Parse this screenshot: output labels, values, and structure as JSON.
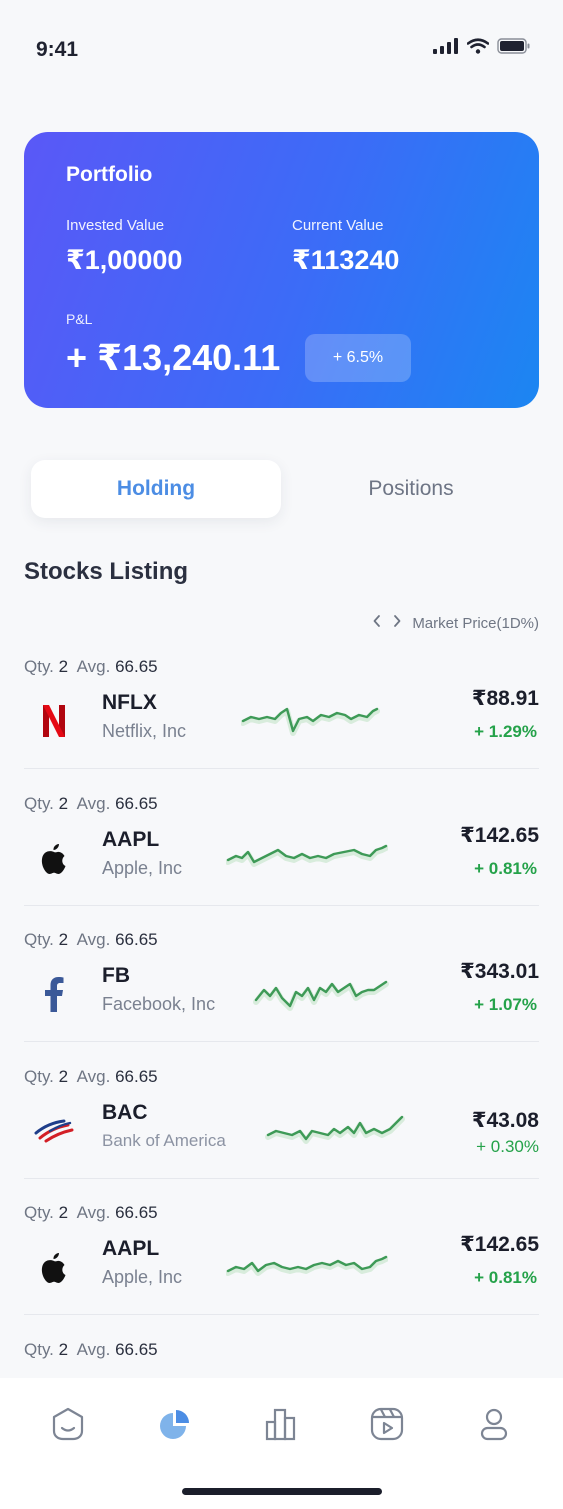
{
  "status_bar": {
    "time": "9:41"
  },
  "portfolio": {
    "title": "Portfolio",
    "invested_label": "Invested Value",
    "invested_value": "₹1,00000",
    "current_label": "Current Value",
    "current_value": "₹113240",
    "pl_label": "P&L",
    "pl_value": "+ ₹13,240.11",
    "pl_percent": "+ 6.5%"
  },
  "tabs": {
    "holding": "Holding",
    "positions": "Positions",
    "active": "Holding"
  },
  "listing": {
    "title": "Stocks Listing",
    "market_price_label": "Market Price(1D%)",
    "qty_label": "Qty.",
    "avg_label": "Avg.",
    "stocks": [
      {
        "qty": "2",
        "avg": "66.65",
        "symbol": "NFLX",
        "name": "Netflix, Inc",
        "price": "₹88.91",
        "change": "+ 1.29%",
        "logo": "netflix-logo"
      },
      {
        "qty": "2",
        "avg": "66.65",
        "symbol": "AAPL",
        "name": "Apple, Inc",
        "price": "₹142.65",
        "change": "+ 0.81%",
        "logo": "apple-logo"
      },
      {
        "qty": "2",
        "avg": "66.65",
        "symbol": "FB",
        "name": "Facebook, Inc",
        "price": "₹343.01",
        "change": "+ 1.07%",
        "logo": "facebook-logo"
      },
      {
        "qty": "2",
        "avg": "66.65",
        "symbol": "BAC",
        "name": "Bank of America",
        "price": "₹43.08",
        "change": "+ 0.30%",
        "logo": "bank-of-america-logo"
      },
      {
        "qty": "2",
        "avg": "66.65",
        "symbol": "AAPL",
        "name": "Apple, Inc",
        "price": "₹142.65",
        "change": "+ 0.81%",
        "logo": "apple-logo"
      }
    ],
    "partial_row": {
      "qty": "2",
      "avg": "66.65"
    }
  },
  "nav": {
    "items": [
      "home-icon",
      "portfolio-pie-icon",
      "bar-chart-icon",
      "video-icon",
      "profile-icon"
    ],
    "active": "portfolio-pie-icon"
  },
  "colors": {
    "accent": "#4c8de4",
    "positive": "#25a24a",
    "card_gradient_start": "#5a58f7",
    "card_gradient_end": "#1b86f2"
  }
}
